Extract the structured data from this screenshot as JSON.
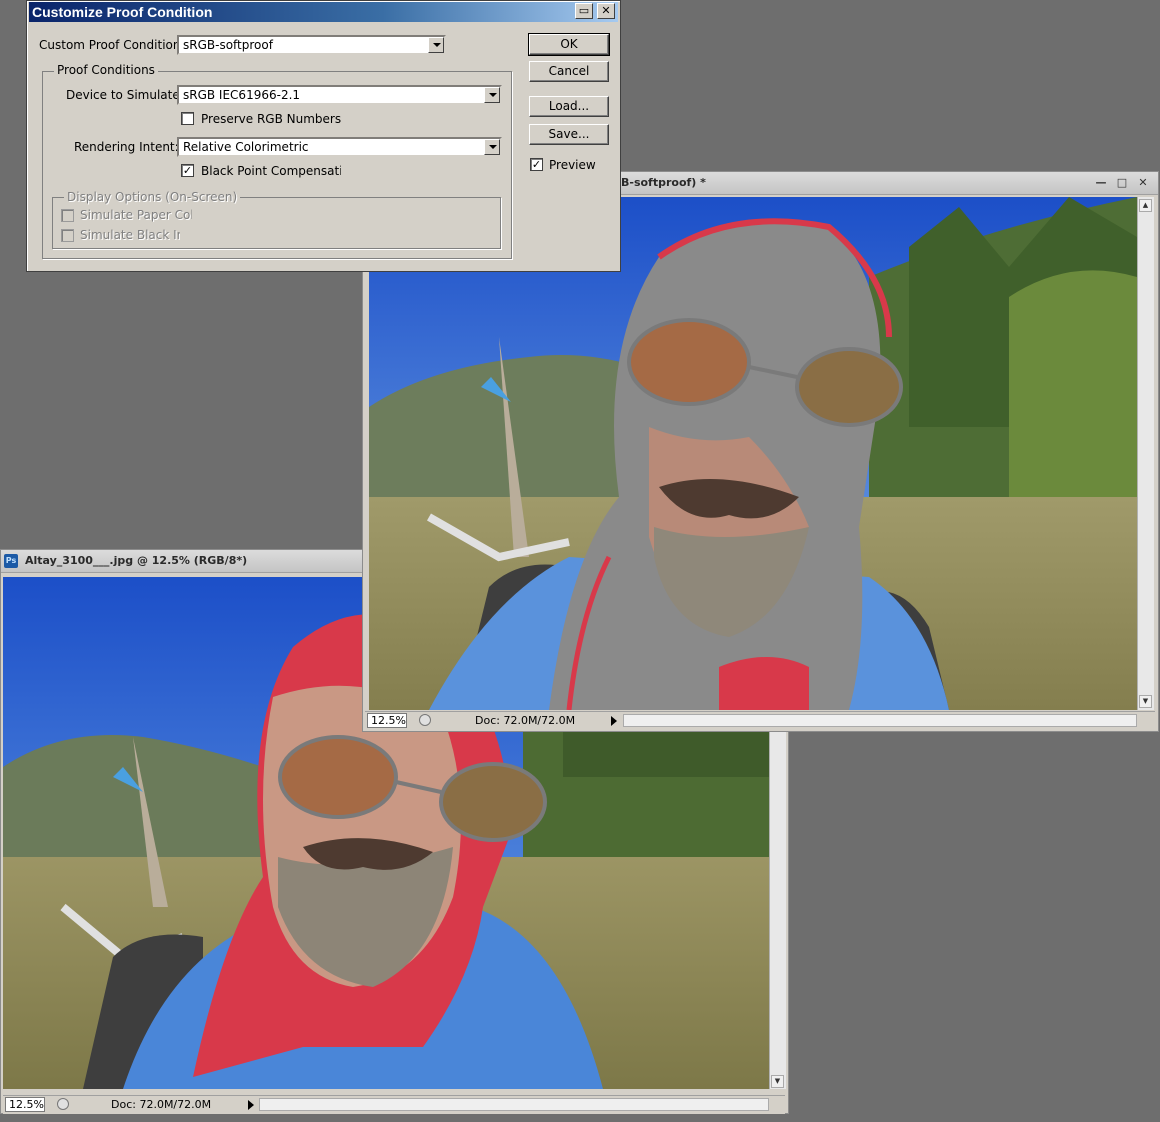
{
  "dialog": {
    "title": "Customize Proof Condition",
    "custom_proof_label": "Custom Proof Condition:",
    "custom_proof_value": "sRGB-softproof",
    "proof_conditions_label": "Proof Conditions",
    "device_label": "Device to Simulate:",
    "device_value": "sRGB IEC61966-2.1",
    "preserve_label": "Preserve RGB Numbers",
    "preserve_checked": false,
    "intent_label": "Rendering Intent:",
    "intent_value": "Relative Colorimetric",
    "bpc_label": "Black Point Compensation",
    "bpc_checked": true,
    "display_options_label": "Display Options (On-Screen)",
    "sim_paper_label": "Simulate Paper Color",
    "sim_ink_label": "Simulate Black Ink",
    "ok_label": "OK",
    "cancel_label": "Cancel",
    "load_label": "Load...",
    "save_label": "Save...",
    "preview_label": "Preview",
    "preview_checked": true,
    "maximize_glyph": "▭",
    "close_glyph": "✕"
  },
  "back_window": {
    "title": "Altay_3100___.jpg @ 12.5% (RGB/8*)",
    "app_icon": "Ps",
    "zoom": "12.5%",
    "doc_info": "Doc: 72.0M/72.0M"
  },
  "front_window": {
    "title": "B-softproof) *",
    "zoom": "12.5%",
    "doc_info": "Doc: 72.0M/72.0M",
    "minimize_glyph": "—",
    "restore_glyph": "□",
    "close_glyph": "✕"
  },
  "colors": {
    "workspace": "#6e6e6e",
    "gamut_warning": "#8a8a8a",
    "bandana": "#d8394a",
    "sky": "#3f7fe0"
  }
}
